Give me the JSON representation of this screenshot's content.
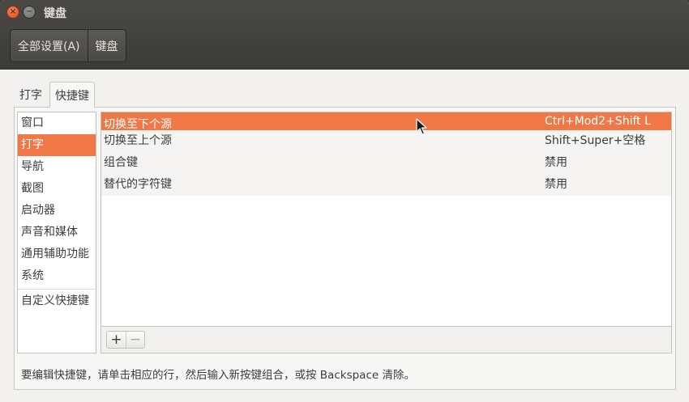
{
  "window": {
    "title": "键盘",
    "close_glyph": "×",
    "minimize_glyph": "−"
  },
  "toolbar": {
    "all_settings_label": "全部设置(A)",
    "current_label": "键盘"
  },
  "tabs": [
    {
      "label": "打字",
      "active": false
    },
    {
      "label": "快捷键",
      "active": true
    }
  ],
  "categories": {
    "items": [
      "窗口",
      "打字",
      "导航",
      "截图",
      "启动器",
      "声音和媒体",
      "通用辅助功能",
      "系统"
    ],
    "selected": "打字",
    "custom": "自定义快捷键"
  },
  "shortcuts": {
    "rows": [
      {
        "name": "切换至下个源",
        "accel": "Ctrl+Mod2+Shift L",
        "selected": true
      },
      {
        "name": "切换至上个源",
        "accel": "Shift+Super+空格",
        "selected": false
      },
      {
        "name": "组合键",
        "accel": "禁用",
        "selected": false
      },
      {
        "name": "替代的字符键",
        "accel": "禁用",
        "selected": false
      }
    ],
    "add_glyph": "+",
    "remove_glyph": "−"
  },
  "hint": "要编辑快捷键，请单击相应的行，然后输入新按键组合，或按 Backspace 清除。",
  "colors": {
    "selection": "#f07746",
    "titlebar": "#3c3b37",
    "close_button": "#df4a16"
  },
  "icons": {
    "close": "close-icon",
    "minimize": "minimize-icon",
    "add": "add-icon",
    "remove": "remove-icon",
    "cursor": "mouse-pointer-icon"
  }
}
